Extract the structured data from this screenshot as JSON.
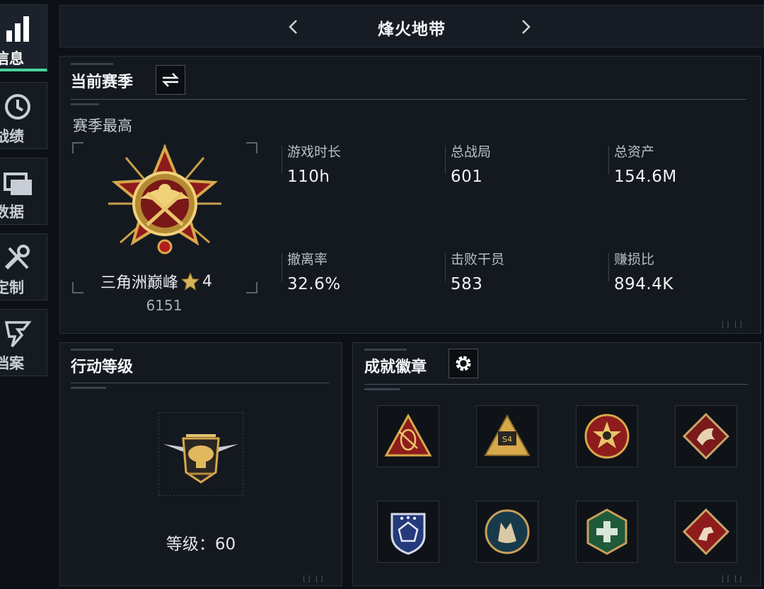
{
  "sidebar": {
    "items": [
      {
        "label": "人信息",
        "icon": "bar-chart-icon",
        "active": true
      },
      {
        "label": "史战绩",
        "icon": "clock-icon",
        "active": false
      },
      {
        "label": "细数据",
        "icon": "cards-icon",
        "active": false
      },
      {
        "label": "枝定制",
        "icon": "wrench-icon",
        "active": false
      },
      {
        "label": "警档案",
        "icon": "lightning-icon",
        "active": false
      }
    ]
  },
  "header": {
    "title": "烽火地带",
    "prev_icon": "chevron-left-icon",
    "next_icon": "chevron-right-icon"
  },
  "season": {
    "title": "当前赛季",
    "switch_icon": "swap-icon",
    "subtitle": "赛季最高",
    "rank_name": "三角洲巅峰",
    "rank_star_icon": "star-icon",
    "rank_tier": "4",
    "rank_score": "6151",
    "stats": [
      {
        "label": "游戏时长",
        "value": "110h"
      },
      {
        "label": "总战局",
        "value": "601"
      },
      {
        "label": "总资产",
        "value": "154.6M"
      },
      {
        "label": "撤离率",
        "value": "32.6%"
      },
      {
        "label": "击败干员",
        "value": "583"
      },
      {
        "label": "赚损比",
        "value": "894.4K"
      }
    ]
  },
  "action_level": {
    "title": "行动等级",
    "level_text": "等级：60",
    "emblem_icon": "helicopter-emblem-icon"
  },
  "achievements": {
    "title": "成就徽章",
    "settings_icon": "gear-icon",
    "badges": [
      "triangle-radar-badge-icon",
      "triangle-s4-badge-icon",
      "round-skull-badge-icon",
      "diamond-dragon-badge-icon",
      "shield-star-badge-icon",
      "round-wolf-badge-icon",
      "hexagon-medic-badge-icon",
      "diamond-runner-badge-icon"
    ]
  },
  "colors": {
    "accent": "#46d39a",
    "gold": "#d7a94a",
    "red": "#9c1c1c",
    "panel": "#141920",
    "background": "#0d1117"
  }
}
